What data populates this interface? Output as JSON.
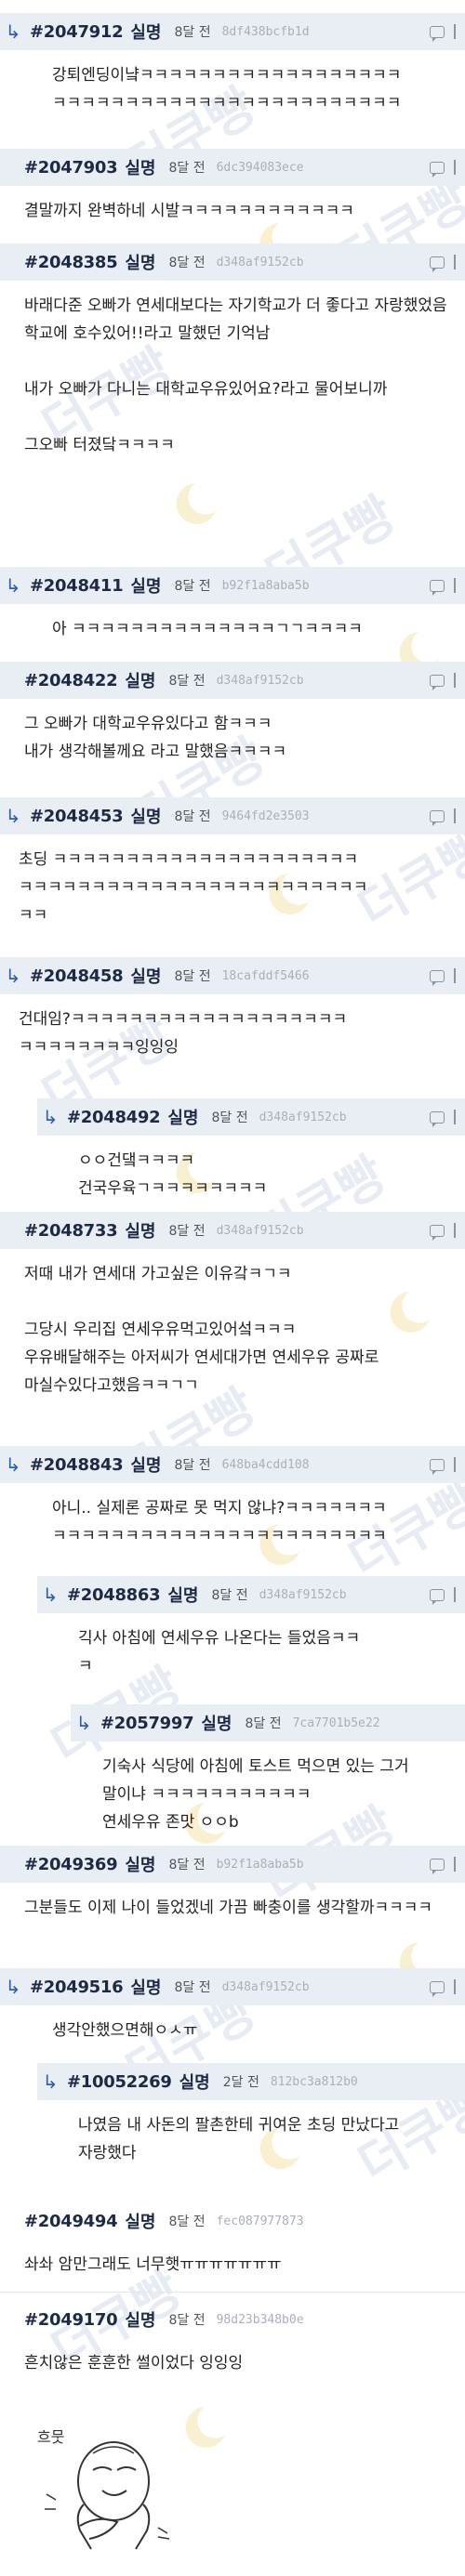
{
  "comments": [
    {
      "num": "#2047912",
      "author": "실명",
      "time": "8달 전",
      "hash": "8df438bcfb1d",
      "reply": true,
      "lines": [
        "강퇴엔딩이냨ㅋㅋㅋㅋㅋㅋㅋㅋㅋㅋㅋㅋㅋㅋㅋㅋㅋㅋ",
        "ㅋㅋㅋㅋㅋㅋㅋㅋㅋㅋㅋㅋㅋㅋㅋㅋㅋㅋㅋㅋㅋㅋㅋㅋ"
      ]
    },
    {
      "num": "#2047903",
      "author": "실명",
      "time": "8달 전",
      "hash": "6dc394083ece",
      "reply": false,
      "lines": [
        "결말까지 완벽하네 시발ㅋㅋㅋㅋㅋㅋㅋㅋㅋㅋㅋㅋ"
      ]
    },
    {
      "num": "#2048385",
      "author": "실명",
      "time": "8달 전",
      "hash": "d348af9152cb",
      "reply": false,
      "lines": [
        "바래다준 오빠가 연세대보다는 자기학교가 더 좋다고 자랑했었음",
        "학교에 호수있어!!라고 말했던 기억남",
        "",
        "내가 오빠가 다니는 대학교우유있어요?라고 물어보니까",
        "",
        "그오빠 터졌닼ㅋㅋㅋㅋ"
      ]
    },
    {
      "num": "#2048411",
      "author": "실명",
      "time": "8달 전",
      "hash": "b92f1a8aba5b",
      "reply": true,
      "lines": [
        "아 ㅋㅋㅋㅋㅋㅋㅋㅋㅋㅋㅋㅋㅋㅋㄱㄱㅋㅋㅋㅋ"
      ]
    },
    {
      "num": "#2048422",
      "author": "실명",
      "time": "8달 전",
      "hash": "d348af9152cb",
      "reply": false,
      "lines": [
        "그 오빠가 대학교우유있다고 함ㅋㅋㅋ",
        "내가 생각해볼께요 라고 말했음ㅋㅋㅋㅋ"
      ]
    },
    {
      "num": "#2048453",
      "author": "실명",
      "time": "8달 전",
      "hash": "9464fd2e3503",
      "reply": true,
      "lines": [
        "초딩 ㅋㅋㅋㅋㅋㅋㅋㅋㅋㅋㅋㅋㅋㅋㅋㅋㅋㅋㅋㅋㅋ",
        "ㅋㅋㅋㅋㅋㅋㅋㅋㅋㅋㅋㅋㅋㅋㅋㅋㅋㅋㅋㅋㅋㅋㅋㅋ",
        "ㅋㅋ"
      ]
    },
    {
      "num": "#2048458",
      "author": "실명",
      "time": "8달 전",
      "hash": "18cafddf5466",
      "reply": true,
      "lines": [
        "건대임?ㅋㅋㅋㅋㅋㅋㅋㅋㅋㅋㅋㅋㅋㅋㅋㅋㅋㅋㅋ",
        "ㅋㅋㅋㅋㅋㅋㅋㅋ잉잉잉"
      ]
    },
    {
      "num": "#2048492",
      "author": "실명",
      "time": "8달 전",
      "hash": "d348af9152cb",
      "reply": true,
      "lines": [
        "ㅇㅇ건댘ㅋㅋㅋㅋ",
        "건국우육ㄱㅋㅋㅋㅋㅋㅋㅋㅋ"
      ]
    },
    {
      "num": "#2048733",
      "author": "실명",
      "time": "8달 전",
      "hash": "d348af9152cb",
      "reply": false,
      "lines": [
        "저때 내가 연세대 가고싶은 이유갘ㅋㄱㅋ",
        "",
        "그당시 우리집 연세우유먹고있어섴ㅋㅋㅋ",
        "우유배달해주는 아저씨가 연세대가면 연세우유 공짜로 마실수있다고했음ㅋㅋㄱㄱ"
      ]
    },
    {
      "num": "#2048843",
      "author": "실명",
      "time": "8달 전",
      "hash": "648ba4cdd108",
      "reply": true,
      "lines": [
        "아니.. 실제론 공짜로 못 먹지 않냐?ㅋㅋㅋㅋㅋㅋㅋ",
        "ㅋㅋㅋㅋㅋㅋㅋㅋㅋㅋㅋㅋㅋㅋㅋㅋㅋㅋㅋㅋㅋㅋㅋ"
      ]
    },
    {
      "num": "#2048863",
      "author": "실명",
      "time": "8달 전",
      "hash": "d348af9152cb",
      "reply": true,
      "lines": [
        "긱사 아침에 연세우유 나온다는 들었음ㅋㅋ",
        "ㅋ"
      ]
    },
    {
      "num": "#2057997",
      "author": "실명",
      "time": "8달 전",
      "hash": "7ca7701b5e22",
      "reply": true,
      "lines": [
        "기숙사 식당에 아침에 토스트 먹으면 있는 그거 말이냐 ㅋㅋㅋㅋㅋㅋㅋㅋㅋㅋㅋ",
        "연세우유 존맛 ㅇㅇb"
      ]
    },
    {
      "num": "#2049369",
      "author": "실명",
      "time": "8달 전",
      "hash": "b92f1a8aba5b",
      "reply": false,
      "lines": [
        "그분들도 이제 나이 들었겠네 가끔 빠충이를 생각할까ㅋㅋㅋㅋ"
      ]
    },
    {
      "num": "#2049516",
      "author": "실명",
      "time": "8달 전",
      "hash": "d348af9152cb",
      "reply": true,
      "lines": [
        "생각안했으면해ㅇㅅㅠ"
      ]
    },
    {
      "num": "#10052269",
      "author": "실명",
      "time": "2달 전",
      "hash": "812bc3a812b0",
      "reply": true,
      "lines": [
        "나였음 내 사돈의 팔촌한테 귀여운 초딩 만났다고 자랑했다"
      ]
    },
    {
      "num": "#2049494",
      "author": "실명",
      "time": "8달 전",
      "hash": "fec087977873",
      "reply": false,
      "lines": [
        "솨솨 암만그래도 너무햇ㅠㅠㅠㅠㅠㅠㅠ"
      ]
    },
    {
      "num": "#2049170",
      "author": "실명",
      "time": "8달 전",
      "hash": "98d23b348b0e",
      "reply": false,
      "lines": [
        "흔치않은 훈훈한 썰이었다 잉잉잉"
      ]
    }
  ],
  "watermark": {
    "text": "더쿠빵"
  },
  "sketch": {
    "caption": "흐뭇"
  },
  "colors": {
    "header_bg": "#e9edf4",
    "reply_arrow": "#2f5fb0",
    "watermark": "#c9d3e8",
    "watermark_moon": "#f4e6b3"
  }
}
